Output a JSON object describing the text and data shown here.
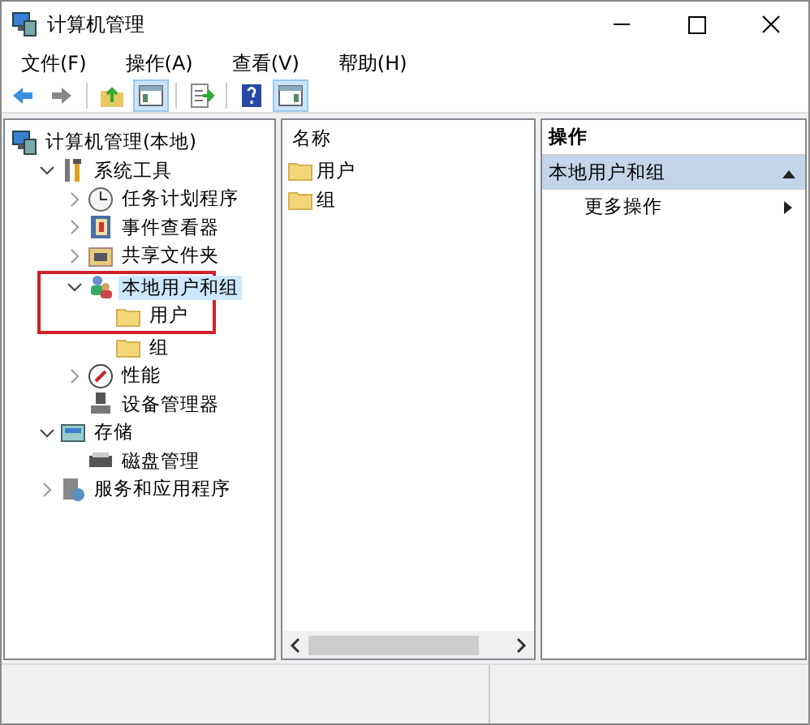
{
  "window": {
    "title": "计算机管理"
  },
  "menu": [
    {
      "label": "文件(F)"
    },
    {
      "label": "操作(A)"
    },
    {
      "label": "查看(V)"
    },
    {
      "label": "帮助(H)"
    }
  ],
  "toolbar": [
    {
      "kind": "back",
      "pressed": false
    },
    {
      "kind": "forward",
      "pressed": false
    },
    {
      "kind": "sep"
    },
    {
      "kind": "up",
      "pressed": false
    },
    {
      "kind": "tree",
      "pressed": true
    },
    {
      "kind": "sep"
    },
    {
      "kind": "export",
      "pressed": false
    },
    {
      "kind": "sep"
    },
    {
      "kind": "help",
      "pressed": false
    },
    {
      "kind": "pane",
      "pressed": true
    }
  ],
  "tree": [
    {
      "label": "计算机管理(本地)",
      "kind": "computer",
      "selected": false,
      "children": [
        {
          "label": "系统工具",
          "kind": "tools",
          "selected": false,
          "expanded": true,
          "children": [
            {
              "label": "任务计划程序",
              "kind": "clock",
              "selected": false,
              "expanded": false
            },
            {
              "label": "事件查看器",
              "kind": "event",
              "selected": false,
              "expanded": false
            },
            {
              "label": "共享文件夹",
              "kind": "share",
              "selected": false,
              "expanded": false
            },
            {
              "label": "本地用户和组",
              "kind": "users",
              "selected": true,
              "expanded": true,
              "highlighted": true,
              "children": [
                {
                  "label": "用户",
                  "kind": "folder",
                  "selected": false
                },
                {
                  "label": "组",
                  "kind": "folder",
                  "selected": false
                }
              ]
            },
            {
              "label": "性能",
              "kind": "perf",
              "selected": false,
              "expanded": false
            },
            {
              "label": "设备管理器",
              "kind": "device",
              "selected": false
            }
          ]
        },
        {
          "label": "存储",
          "kind": "storage",
          "selected": false,
          "expanded": true,
          "children": [
            {
              "label": "磁盘管理",
              "kind": "disk",
              "selected": false
            }
          ]
        },
        {
          "label": "服务和应用程序",
          "kind": "services",
          "selected": false,
          "expanded": false
        }
      ]
    }
  ],
  "list": {
    "column": "名称",
    "items": [
      {
        "label": "用户"
      },
      {
        "label": "组"
      }
    ]
  },
  "actions": {
    "header": "操作",
    "sections": [
      {
        "title": "本地用户和组",
        "expanded": true,
        "items": [
          {
            "label": "更多操作"
          }
        ]
      }
    ]
  }
}
